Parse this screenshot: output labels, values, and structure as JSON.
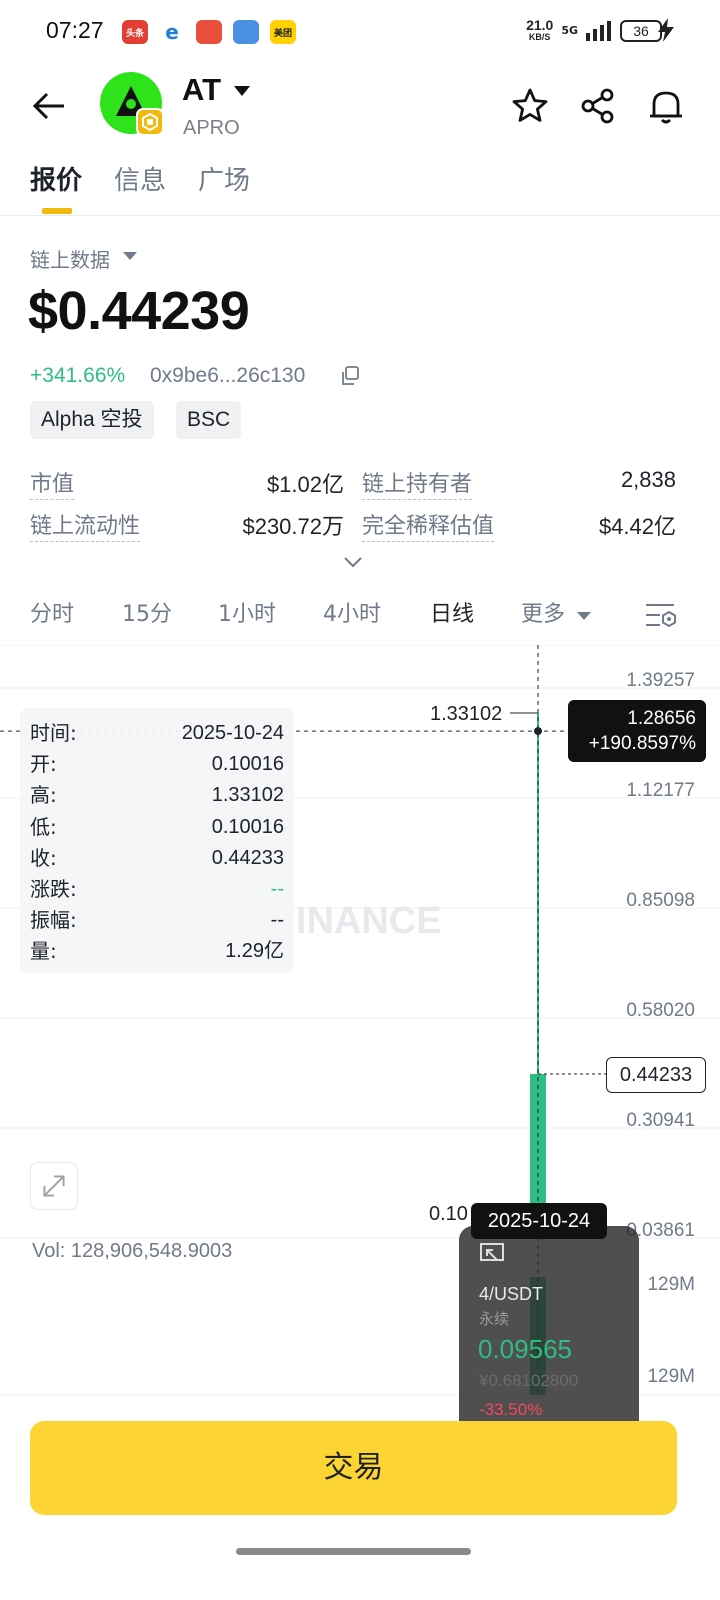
{
  "status_bar": {
    "time": "07:27",
    "apps": [
      {
        "name": "toutiao",
        "label": "头条",
        "color": "#e33e33"
      },
      {
        "name": "edge",
        "label": "e",
        "color": "#1e7fd6"
      },
      {
        "name": "app3",
        "label": "",
        "color": "#e84f3d"
      },
      {
        "name": "weather",
        "label": "",
        "color": "#4a90e2"
      },
      {
        "name": "meituan",
        "label": "美团",
        "color": "#ffd100"
      }
    ],
    "speed_value": "21.0",
    "speed_unit": "KB/S",
    "network": "5G",
    "battery": "36"
  },
  "header": {
    "symbol": "AT",
    "name": "APRO",
    "icons": [
      "back-arrow-icon",
      "star-icon",
      "share-icon",
      "bell-icon"
    ]
  },
  "tabs": [
    {
      "label": "报价",
      "active": true
    },
    {
      "label": "信息",
      "active": false
    },
    {
      "label": "广场",
      "active": false
    }
  ],
  "price_section": {
    "source": "链上数据",
    "price": "$0.44239",
    "change": "+341.66%",
    "address": "0x9be6...26c130",
    "tags": [
      "Alpha 空投",
      "BSC"
    ]
  },
  "stats": [
    {
      "label": "市值",
      "value": "$1.02亿"
    },
    {
      "label": "链上持有者",
      "value": "2,838"
    },
    {
      "label": "链上流动性",
      "value": "$230.72万"
    },
    {
      "label": "完全稀释估值",
      "value": "$4.42亿"
    }
  ],
  "intervals": [
    "分时",
    "15分",
    "1小时",
    "4小时",
    "日线",
    "更多"
  ],
  "active_interval": "日线",
  "chart_data": {
    "type": "candlestick",
    "y_axis_ticks": [
      "1.39257",
      "1.12177",
      "0.85098",
      "0.58020",
      "0.30941",
      "0.03861"
    ],
    "ylim": [
      0.03861,
      1.39257
    ],
    "candles": [
      {
        "date": "2025-10-24",
        "open": 0.10016,
        "high": 1.33102,
        "low": 0.10016,
        "close": 0.44233
      }
    ],
    "crosshair_price": "1.28656",
    "crosshair_change": "+190.8597%",
    "crosshair_date": "2025-10-24",
    "high_label": "1.33102",
    "low_label": "0.10",
    "last_price": "0.44233",
    "volume_ticks": [
      "129M",
      "129M"
    ],
    "volume_label": "Vol: 128,906,548.9003",
    "watermark": "BINANCE",
    "colors": {
      "up": "#2ebd85",
      "down": "#f6465d"
    }
  },
  "info_panel": [
    {
      "key": "时间:",
      "value": "2025-10-24"
    },
    {
      "key": "开:",
      "value": "0.10016"
    },
    {
      "key": "高:",
      "value": "1.33102"
    },
    {
      "key": "低:",
      "value": "0.10016"
    },
    {
      "key": "收:",
      "value": "0.44233"
    },
    {
      "key": "涨跌:",
      "value": "--"
    },
    {
      "key": "振幅:",
      "value": "--"
    },
    {
      "key": "量:",
      "value": "1.29亿"
    }
  ],
  "floating_widget": {
    "pair": "4/USDT",
    "type": "永续",
    "price": "0.09565",
    "cny": "¥0.68102800",
    "change": "-33.50%"
  },
  "trade_button": "交易",
  "colors": {
    "brand_yellow": "#fcd535",
    "accent": "#f0b90b",
    "green": "#2ebd85",
    "red": "#f6465d"
  }
}
